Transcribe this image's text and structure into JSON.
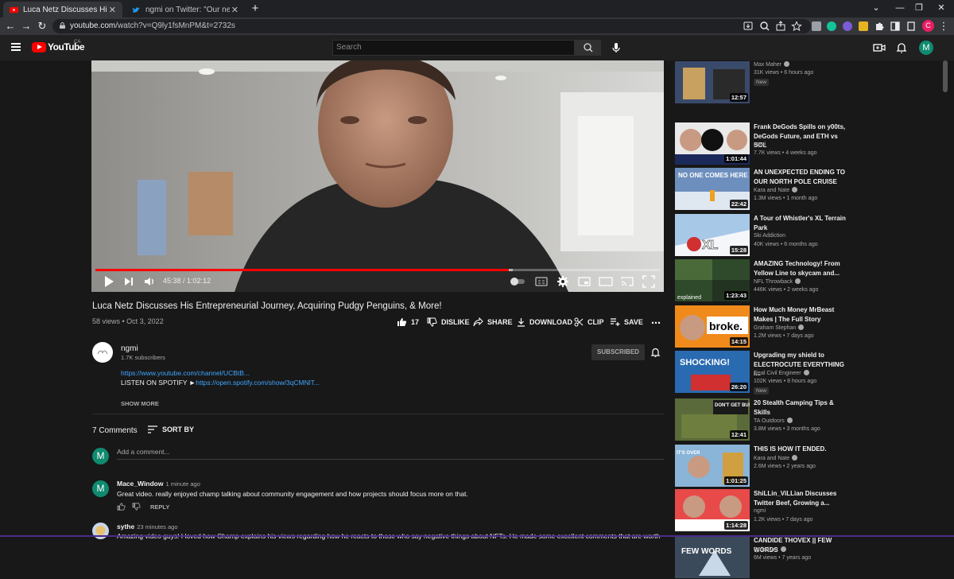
{
  "browser": {
    "tabs": [
      {
        "title": "Luca Netz Discusses His Entrepre",
        "active": true,
        "favicon": "youtube-icon"
      },
      {
        "title": "ngmi on Twitter: \"Our newest ep",
        "active": false,
        "favicon": "twitter-icon"
      }
    ],
    "new_tab": "+",
    "url_domain": "youtube.com",
    "url_path": "/watch?v=Q9ly1fsMnPM&t=2732s",
    "profile_initial": "C"
  },
  "header": {
    "logo": "YouTube",
    "country": "CA",
    "search_placeholder": "Search",
    "avatar_initial": "M"
  },
  "player": {
    "time_current": "45:38",
    "time_total": "1:02:12",
    "progress": 0.733
  },
  "video": {
    "title": "Luca Netz Discusses His Entrepreneurial Journey, Acquiring Pudgy Penguins, & More!",
    "meta": "58 views • Oct 3, 2022",
    "likes": "17",
    "dislike_label": "DISLIKE",
    "share_label": "SHARE",
    "download_label": "DOWNLOAD",
    "clip_label": "CLIP",
    "save_label": "SAVE"
  },
  "channel": {
    "name": "ngmi",
    "subscribers": "1.7K subscribers",
    "subscribed_label": "SUBSCRIBED",
    "desc_link": "https://www.youtube.com/channel/UCBtB...",
    "desc_spotify_label": "LISTEN ON SPOTIFY ►",
    "desc_spotify_link": "https://open.spotify.com/show/3qCMNlT...",
    "show_more": "SHOW MORE"
  },
  "comments": {
    "count_label": "7 Comments",
    "sort_label": "SORT BY",
    "add_placeholder": "Add a comment...",
    "my_initial": "M",
    "items": [
      {
        "author": "Mace_Window",
        "time": "1 minute ago",
        "initial": "M",
        "text": "Great video. really enjoyed champ talking about community engagement and how projects should focus more on that.",
        "reply": "REPLY"
      },
      {
        "author": "sythe",
        "time": "23 minutes ago",
        "initial": "",
        "text": "Amazing video guys! I loved how Champ explains his views regarding how he reacts to those who say negative things about NFTs. He made some excellent comments that are worth"
      }
    ]
  },
  "sidebar": {
    "items": [
      {
        "title": "",
        "channel": "Max Maher",
        "verified": true,
        "meta": "31K views • 6 hours ago",
        "badge": "New",
        "duration": "12:57"
      },
      {
        "title": "Frank DeGods Spills on y00ts, DeGods Future, and ETH vs SOL",
        "channel": "ngmi",
        "verified": false,
        "meta": "7.7K views • 4 weeks ago",
        "badge": "",
        "duration": "1:01:44"
      },
      {
        "title": "AN UNEXPECTED ENDING TO OUR NORTH POLE CRUISE",
        "channel": "Kara and Nate",
        "verified": true,
        "meta": "1.3M views • 1 month ago",
        "badge": "",
        "duration": "22:42"
      },
      {
        "title": "A Tour of Whistler's XL Terrain Park",
        "channel": "Ski Addiction",
        "verified": false,
        "meta": "40K views • 6 months ago",
        "badge": "",
        "duration": "15:28"
      },
      {
        "title": "AMAZING Technology! From Yellow Line to skycam and...",
        "channel": "NFL Throwback",
        "verified": true,
        "meta": "446K views • 2 weeks ago",
        "badge": "",
        "duration": "1:23:43"
      },
      {
        "title": "How Much Money MrBeast Makes | The Full Story",
        "channel": "Graham Stephan",
        "verified": true,
        "meta": "1.2M views • 7 days ago",
        "badge": "",
        "duration": "14:15"
      },
      {
        "title": "Upgrading my shield to ELECTROCUTE EVERYTHING i...",
        "channel": "Real Civil Engineer",
        "verified": true,
        "meta": "102K views • 8 hours ago",
        "badge": "New",
        "duration": "26:20"
      },
      {
        "title": "20 Stealth Camping Tips & Skills",
        "channel": "TA Outdoors",
        "verified": true,
        "meta": "3.8M views • 3 months ago",
        "badge": "",
        "duration": "12:41"
      },
      {
        "title": "THIS IS HOW IT ENDED.",
        "channel": "Kara and Nate",
        "verified": true,
        "meta": "2.6M views • 2 years ago",
        "badge": "",
        "duration": "1:01:25"
      },
      {
        "title": "ShiLLin_ViLLian Discusses Twitter Beef, Growing a...",
        "channel": "ngmi",
        "verified": false,
        "meta": "1.2K views • 7 days ago",
        "badge": "",
        "duration": "1:14:28"
      },
      {
        "title": "CANDIDE THOVEX || FEW WORDS",
        "channel": "Quiksilver",
        "verified": true,
        "meta": "6M views • 7 years ago",
        "badge": "",
        "duration": ""
      }
    ],
    "thumb_texts": {
      "t3": "NO ONE COMES HERE",
      "t4": "XL",
      "t5": "explained",
      "t6": "broke.",
      "t7": "SHOCKING!",
      "t8": "DON'T GET BUSTED!",
      "t9": "IT'S OVER",
      "t11": "FEW WORDS"
    }
  },
  "colors": {
    "accent": "#ff0000",
    "link": "#3ea6ff",
    "bg": "#181818"
  }
}
